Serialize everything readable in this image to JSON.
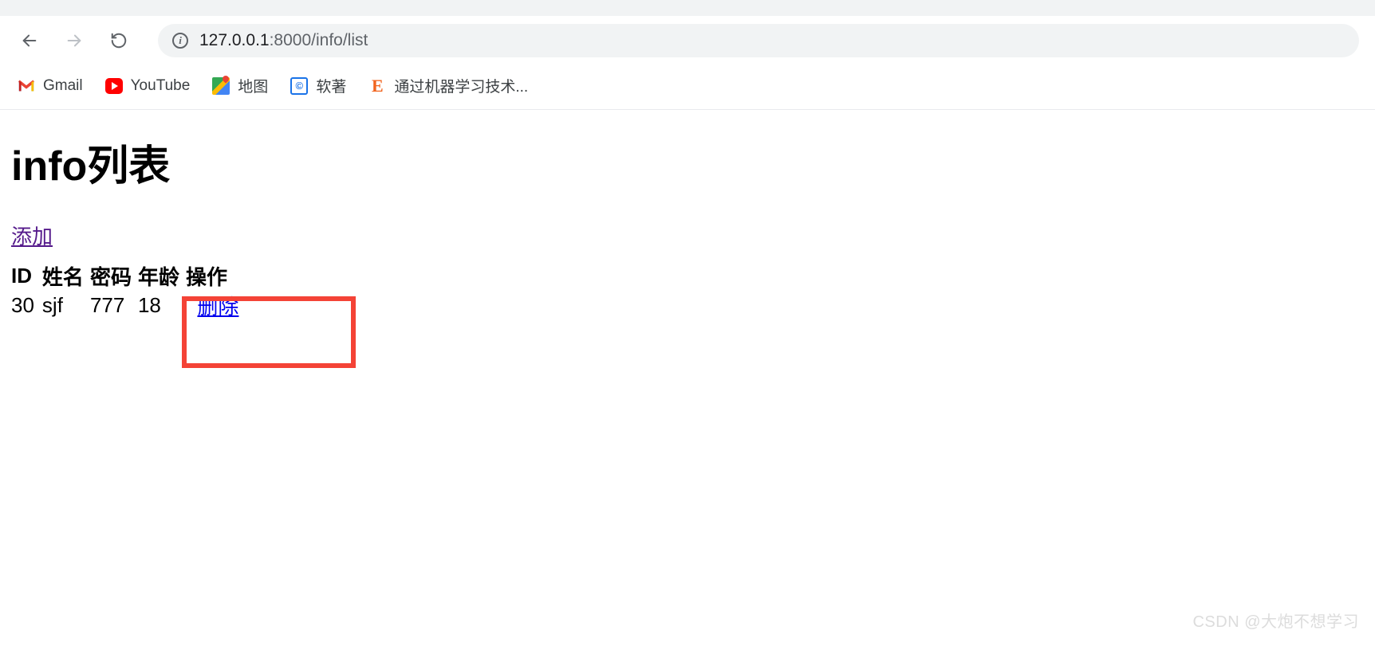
{
  "browser": {
    "url_host": "127.0.0.1",
    "url_port_path": ":8000/info/list"
  },
  "bookmarks": {
    "gmail": "Gmail",
    "youtube": "YouTube",
    "maps": "地图",
    "ruanzhu": "软著",
    "ml": "通过机器学习技术..."
  },
  "page": {
    "title": "info列表",
    "add_link": "添加",
    "headers": {
      "id": "ID",
      "name": "姓名",
      "password": "密码",
      "age": "年龄",
      "op": "操作"
    },
    "rows": [
      {
        "id": "30",
        "name": "sjf",
        "password": "777",
        "age": "18",
        "op": "删除"
      }
    ]
  },
  "watermark": "CSDN @大炮不想学习"
}
